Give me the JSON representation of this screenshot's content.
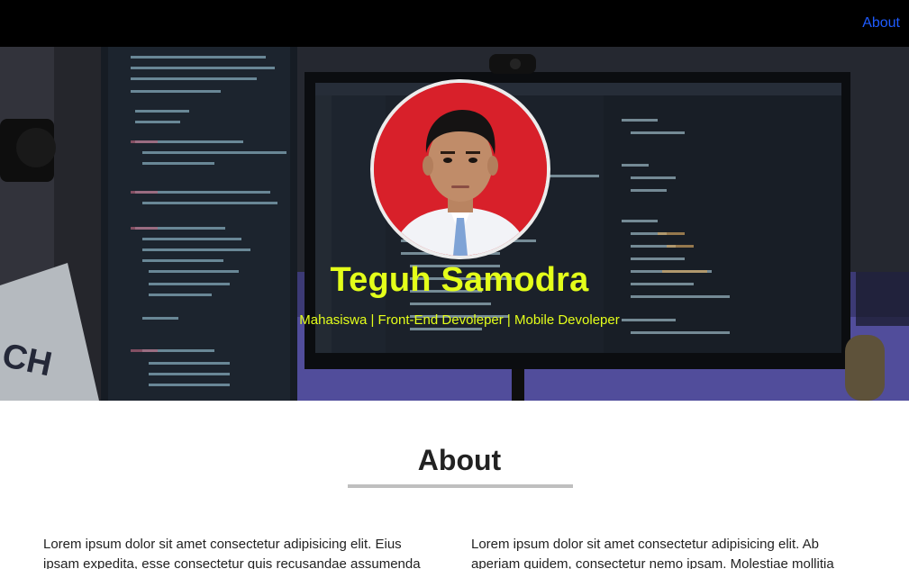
{
  "navbar": {
    "about_link": "About"
  },
  "hero": {
    "name": "Teguh Samodra",
    "tagline": "Mahasiswa | Front-End Devoleper | Mobile Devoleper"
  },
  "about": {
    "title": "About",
    "paragraph_left": "Lorem ipsum dolor sit amet consectetur adipisicing elit. Eius ipsam expedita, esse consectetur quis recusandae assumenda",
    "paragraph_right": "Lorem ipsum dolor sit amet consectetur adipisicing elit. Ab aperiam quidem, consectetur nemo ipsam. Molestiae mollitia"
  },
  "colors": {
    "navbar_bg": "#000000",
    "nav_link": "#1e5bff",
    "hero_text": "#e4ff1a",
    "avatar_bg": "#d8202a"
  }
}
